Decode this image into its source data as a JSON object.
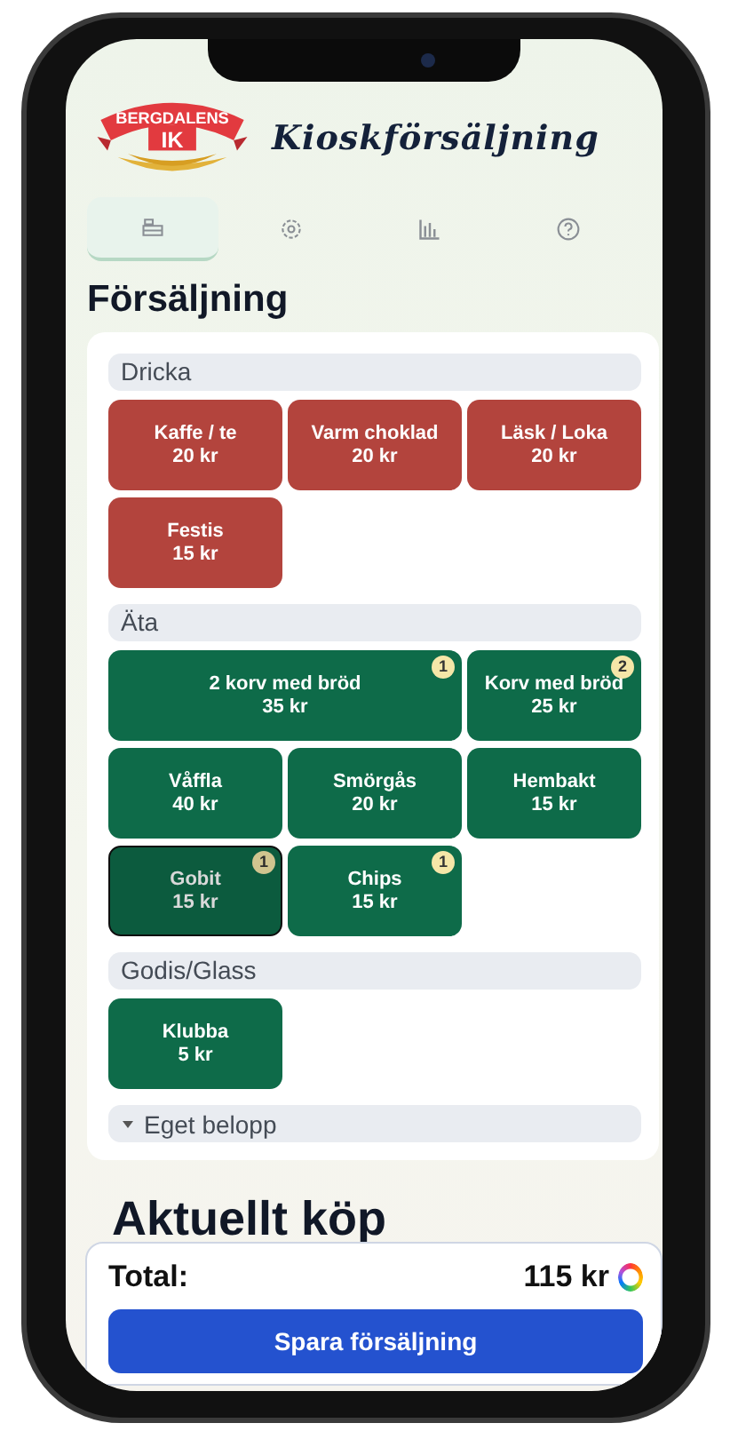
{
  "header": {
    "logo": {
      "top": "BERGDALENS",
      "bottom": "IK"
    },
    "title": "Kioskförsäljning"
  },
  "tabs": [
    {
      "kind": "register",
      "selected": true
    },
    {
      "kind": "settings",
      "selected": false
    },
    {
      "kind": "chart",
      "selected": false
    },
    {
      "kind": "help",
      "selected": false
    }
  ],
  "heading": "Försäljning",
  "categories": [
    {
      "name": "Dricka",
      "color": "#b3443d",
      "items": [
        {
          "kind": "normal",
          "name": "Kaffe / te",
          "price": "20 kr",
          "selected": false
        },
        {
          "kind": "normal",
          "name": "Varm choklad",
          "price": "20 kr",
          "selected": false
        },
        {
          "kind": "normal",
          "name": "Läsk / Loka",
          "price": "20 kr",
          "selected": false
        },
        {
          "kind": "normal",
          "name": "Festis",
          "price": "15 kr",
          "selected": false
        }
      ]
    },
    {
      "name": "Äta",
      "color": "#0e6b49",
      "items": [
        {
          "kind": "wide",
          "name": "2 korv med bröd",
          "price": "35 kr",
          "count": "1",
          "selected": false
        },
        {
          "kind": "normal",
          "name": "Korv med bröd",
          "price": "25 kr",
          "count": "2",
          "selected": false
        },
        {
          "kind": "normal",
          "name": "Våffla",
          "price": "40 kr",
          "selected": false
        },
        {
          "kind": "normal",
          "name": "Smörgås",
          "price": "20 kr",
          "selected": false
        },
        {
          "kind": "normal",
          "name": "Hembakt",
          "price": "15 kr",
          "selected": false
        },
        {
          "kind": "normal",
          "name": "Gobit",
          "price": "15 kr",
          "count": "1",
          "selected": true
        },
        {
          "kind": "normal",
          "name": "Chips",
          "price": "15 kr",
          "count": "1",
          "selected": false
        }
      ]
    },
    {
      "name": "Godis/Glass",
      "color": "#0e6b49",
      "items": [
        {
          "kind": "normal",
          "name": "Klubba",
          "price": "5 kr",
          "selected": false
        }
      ]
    }
  ],
  "custom_amount": {
    "label": "Eget belopp",
    "expanded": false
  },
  "current_purchase": {
    "heading": "Aktuellt köp"
  },
  "footer": {
    "total_label": "Total:",
    "total": "115 kr",
    "save_button": "Spara försäljning"
  }
}
